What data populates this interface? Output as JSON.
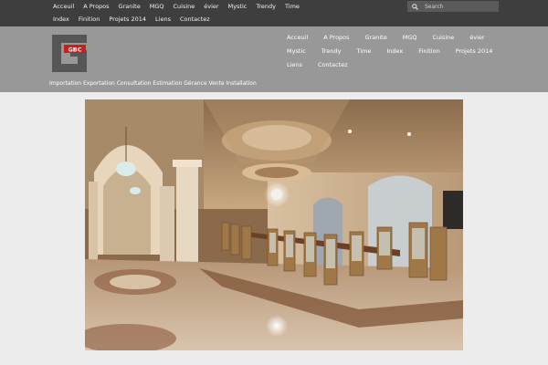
{
  "top_nav": {
    "row1": [
      "Acceuil",
      "A Propos",
      "Granite",
      "MGQ",
      "Cuisine",
      "évier",
      "Mystic",
      "Trendy",
      "Time"
    ],
    "row2": [
      "Index",
      "Finition",
      "Projets 2014",
      "Liens",
      "Contactez"
    ]
  },
  "search": {
    "placeholder": "Search",
    "icon": "search-icon"
  },
  "logo": {
    "text": "GBC",
    "color_dark": "#555555",
    "color_red": "#c8201a"
  },
  "tagline": "Importation Exportation Consultation Estimation Gérance Vente Installation",
  "main_nav": {
    "row1": [
      "Acceuil",
      "A Propos",
      "Granite",
      "MGQ",
      "Cuisine",
      "évier"
    ],
    "row2": [
      "Mystic",
      "Trendy",
      "Time",
      "Index",
      "Finition",
      "Projets 2014"
    ],
    "row3": [
      "Liens",
      "Contactez"
    ]
  },
  "colors": {
    "topbar": "#3e3e3e",
    "header": "#989898",
    "page": "#ececec"
  }
}
